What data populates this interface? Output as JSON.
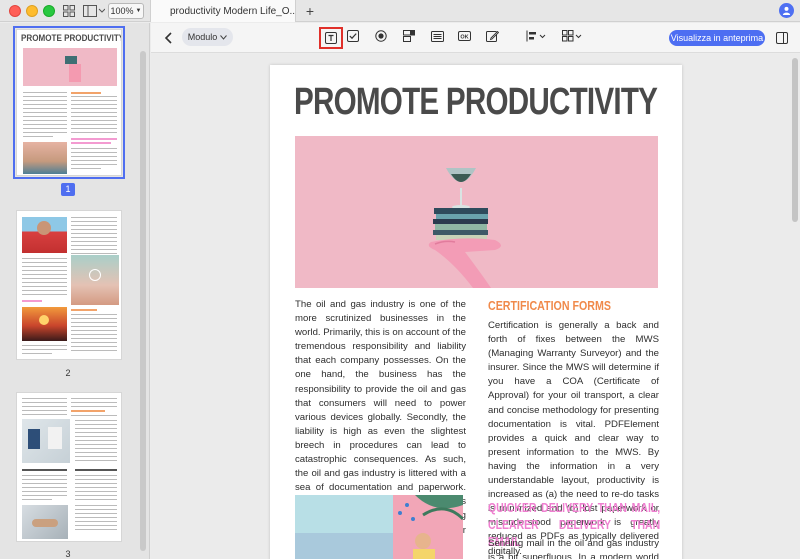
{
  "window": {
    "zoom": "100%",
    "tab_title": "productivity Modern Life_O...",
    "new_tab": "+"
  },
  "toolbar": {
    "mode": "Modulo",
    "preview_label": "Visualizza in anteprima",
    "icons": [
      "text-field-icon",
      "checkbox-icon",
      "radio-button-icon",
      "combo-box-icon",
      "list-box-icon",
      "button-icon",
      "signature-icon",
      "align-icon",
      "grid-icon"
    ]
  },
  "thumbnails": {
    "pages": [
      "1",
      "2",
      "3"
    ],
    "selected": "1",
    "page1_title": "PROMOTE PRODUCTIVITY"
  },
  "document": {
    "title": "PROMOTE PRODUCTIVITY",
    "left_paragraph": "The oil and gas industry is one of the more scrutinized businesses in the world. Primarily, this is on account of the tremendous responsibility and liability that each company possesses. On the one hand, the business has the responsibility to provide the oil and gas that consumers will need to power various devices globally. Secondly, the liability is high as even the slightest breech in procedures can lead to catastrophic consequences. As such, the oil and gas industry is littered with a sea of documentation and paperwork. Having a clear method for this paperwork is vital to increasing productivity and by such profitability for the industry.",
    "heading_certification": "CERTIFICATION FORMS",
    "certification_paragraph": "Certification is generally a back and forth of fixes between the MWS (Managing Warranty Surveyor) and the insurer. Since the MWS will determine if you have a COA (Certificate of Approval) for your oil transport, a clear and concise methodology for presenting documentation is vital. PDFElement provides a quick and clear way to present information to the MWS. By having the information in a very understandable layout, productivity is increased as (a) the need to re-do tasks is minimized and (b) lost paperwork or misunderstood paperwork is greatly reduced as PDFs as typically delivered digitally.",
    "heading_delivery": "QUICKER DELIVERY THAN MAIL, CLEARER DELIVERY THAN EMAIL",
    "delivery_paragraph": "Sending mail in the oil and gas industry is a bit superfluous. In a modern world of"
  },
  "colors": {
    "accent_blue": "#4d6ef2",
    "heading_orange": "#f08a4b",
    "heading_pink": "#ef7fd0",
    "hero_pink": "#f0b9c6",
    "highlight_red": "#e0302a"
  }
}
